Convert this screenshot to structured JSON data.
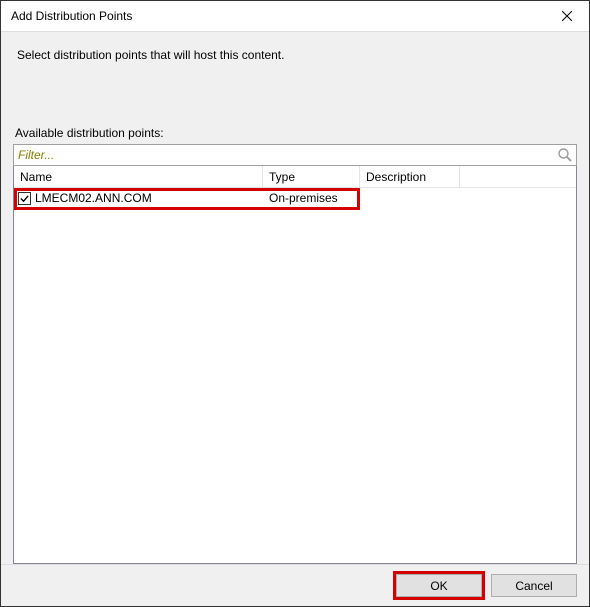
{
  "title": "Add Distribution Points",
  "instruction": "Select distribution points that will host this content.",
  "list_label": "Available distribution points:",
  "filter_placeholder": "Filter...",
  "columns": {
    "name": "Name",
    "type": "Type",
    "description": "Description"
  },
  "rows": [
    {
      "checked": true,
      "name": "LMECM02.ANN.COM",
      "type": "On-premises",
      "description": ""
    }
  ],
  "buttons": {
    "ok": "OK",
    "cancel": "Cancel"
  }
}
